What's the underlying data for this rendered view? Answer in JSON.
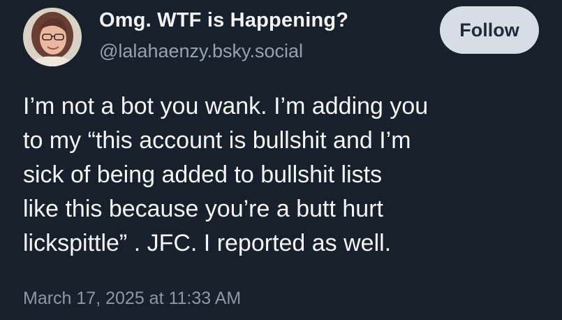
{
  "author": {
    "display_name": "Omg. WTF is Happening?",
    "handle": "@lalahaenzy.bsky.social"
  },
  "follow_button": {
    "label": "Follow"
  },
  "post": {
    "lines": [
      "I’m not a bot you wank. I’m adding you",
      "to my “this account is bullshit and I’m",
      "sick of being added to bullshit lists",
      "like this because you’re a butt hurt",
      "lickspittle” . JFC. I reported as well."
    ],
    "timestamp": "March 17, 2025 at 11:33 AM"
  },
  "colors": {
    "background": "#17202b",
    "handle": "#93a3b4",
    "follow_button_bg": "#d7dde5"
  }
}
